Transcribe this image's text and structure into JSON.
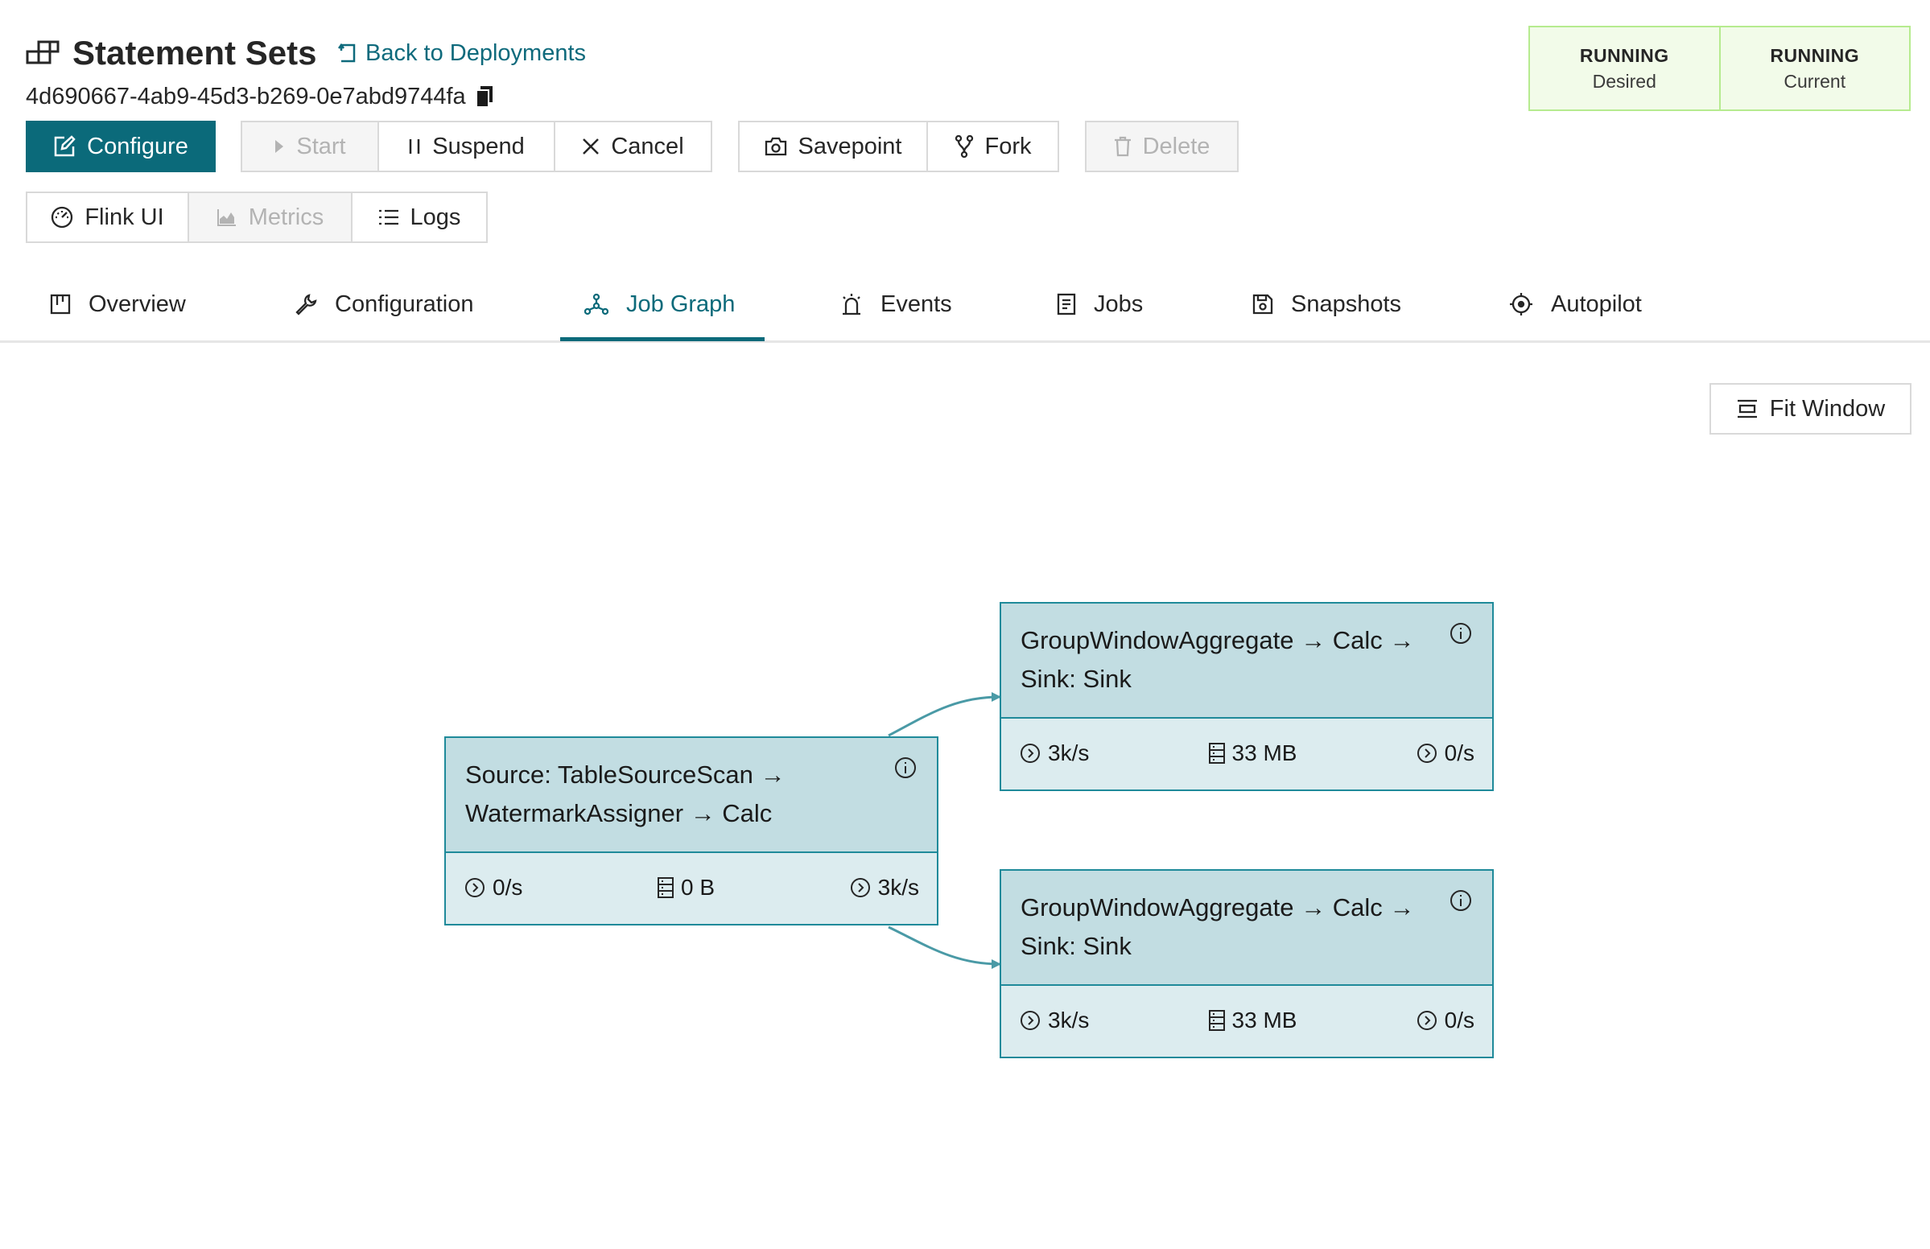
{
  "header": {
    "title": "Statement Sets",
    "back_link": "Back to Deployments",
    "deployment_id": "4d690667-4ab9-45d3-b269-0e7abd9744fa"
  },
  "status": {
    "desired_value": "RUNNING",
    "desired_label": "Desired",
    "current_value": "RUNNING",
    "current_label": "Current"
  },
  "actions": {
    "configure": "Configure",
    "start": "Start",
    "suspend": "Suspend",
    "cancel": "Cancel",
    "savepoint": "Savepoint",
    "fork": "Fork",
    "delete": "Delete",
    "flink_ui": "Flink UI",
    "metrics": "Metrics",
    "logs": "Logs"
  },
  "tabs": [
    {
      "label": "Overview",
      "icon": "board-icon"
    },
    {
      "label": "Configuration",
      "icon": "wrench-icon"
    },
    {
      "label": "Job Graph",
      "icon": "graph-icon",
      "active": true
    },
    {
      "label": "Events",
      "icon": "alarm-icon"
    },
    {
      "label": "Jobs",
      "icon": "document-icon"
    },
    {
      "label": "Snapshots",
      "icon": "save-icon"
    },
    {
      "label": "Autopilot",
      "icon": "target-icon"
    }
  ],
  "graph": {
    "fit_window": "Fit Window",
    "nodes": [
      {
        "title": "Source: TableSourceScan → WatermarkAssigner → Calc",
        "in_rate": "0/s",
        "state_size": "0 B",
        "out_rate": "3k/s"
      },
      {
        "title": "GroupWindowAggregate → Calc → Sink: Sink",
        "in_rate": "3k/s",
        "state_size": "33 MB",
        "out_rate": "0/s"
      },
      {
        "title": "GroupWindowAggregate → Calc → Sink: Sink",
        "in_rate": "3k/s",
        "state_size": "33 MB",
        "out_rate": "0/s"
      }
    ]
  },
  "colors": {
    "accent": "#0b6a7a",
    "node_border": "#1f8a9a",
    "node_header": "#c2dde2",
    "node_body": "#dcecef",
    "status_bg": "#f2fbe9",
    "status_border": "#b6eb8f",
    "edge": "#4a9aa6"
  }
}
